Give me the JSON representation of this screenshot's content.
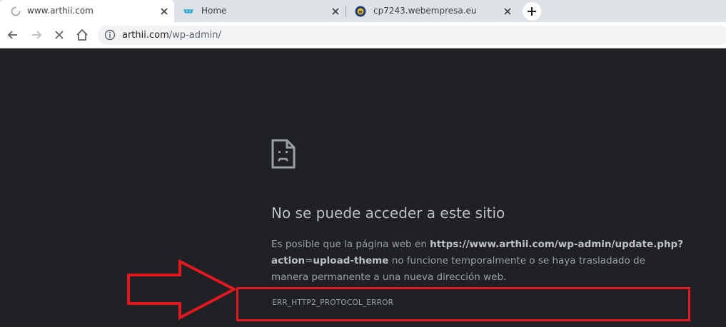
{
  "tabs": [
    {
      "title": "www.arthii.com",
      "favicon": "loading-spinner-icon",
      "active": true
    },
    {
      "title": "Home",
      "favicon": "site-logo-icon",
      "active": false
    },
    {
      "title": "cp7243.webempresa.eu",
      "favicon": "webempresa-logo-icon",
      "active": false
    }
  ],
  "toolbar": {
    "url_host": "arthii.com",
    "url_path": "/wp-admin/"
  },
  "error": {
    "icon": "sad-document-icon",
    "title": "No se puede acceder a este sitio",
    "body_prefix": "Es posible que la página web en ",
    "body_url_1": "https://www.arthii.com/wp-admin/update.php?",
    "body_url_2a": "action",
    "body_url_2b": "=",
    "body_url_2c": "upload-theme",
    "body_suffix": " no funcione temporalmente o se haya trasladado de manera permanente a una nueva dirección web.",
    "code": "ERR_HTTP2_PROTOCOL_ERROR"
  },
  "colors": {
    "annotation": "#e0181f",
    "page_background": "#202124"
  }
}
